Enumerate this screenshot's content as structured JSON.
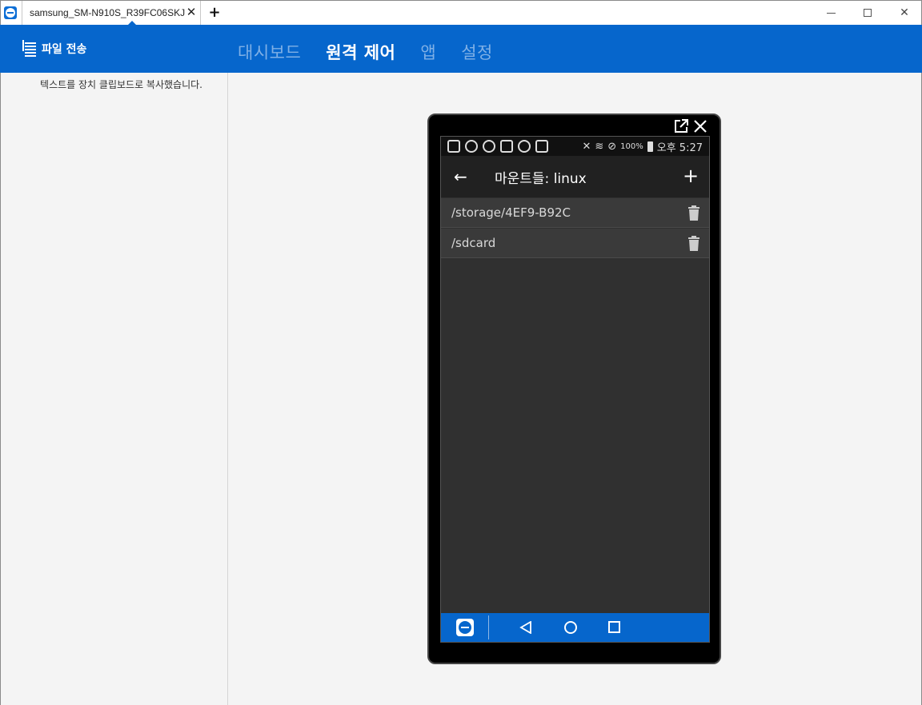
{
  "window": {
    "tab_title": "samsung_SM-N910S_R39FC06SKJ",
    "tab_close": "✕",
    "new_tab": "+",
    "minimize_icon": "minimize-icon",
    "maximize_icon": "maximize-icon",
    "close_icon": "close-icon",
    "close_glyph": "✕"
  },
  "header": {
    "file_transfer_label": "파일 전송",
    "nav": [
      "대시보드",
      "원격 제어",
      "앱",
      "설정"
    ],
    "active_nav": "원격 제어",
    "accent": "#0666cc"
  },
  "left_panel": {
    "message": "텍스트를 장치 클립보드로 복사했습니다."
  },
  "device": {
    "status_bar": {
      "battery": "100%",
      "time": "오후 5:27"
    },
    "appbar": {
      "back_glyph": "←",
      "title": "마운트들: linux",
      "add_glyph": "+"
    },
    "mounts": [
      {
        "path": "/storage/4EF9-B92C"
      },
      {
        "path": "/sdcard"
      }
    ]
  }
}
